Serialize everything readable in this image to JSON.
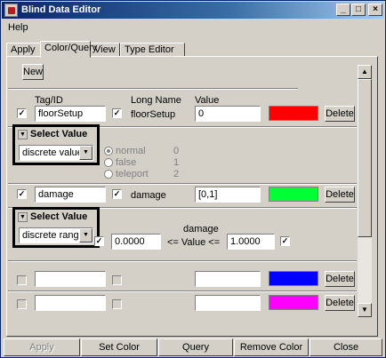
{
  "window": {
    "title": "Blind Data Editor"
  },
  "menu": {
    "items": [
      "Help"
    ]
  },
  "tabs": [
    "Apply",
    "Color/Query",
    "View",
    "Type Editor"
  ],
  "toolbar": {
    "new_label": "New"
  },
  "headers": {
    "tag": "Tag/ID",
    "long_name": "Long Name",
    "value": "Value"
  },
  "rows": [
    {
      "tag": "floorSetup",
      "long_name": "floorSetup",
      "value": "0",
      "color": "#ff0000",
      "delete_label": "Delete",
      "checked": true,
      "long_checked": true
    },
    {
      "tag": "damage",
      "long_name": "damage",
      "value": "[0,1]",
      "color": "#00ff33",
      "delete_label": "Delete",
      "checked": true,
      "long_checked": true
    },
    {
      "tag": "",
      "long_name": "",
      "value": "",
      "color": "#0000ff",
      "delete_label": "Delete",
      "checked": false,
      "long_checked": false
    },
    {
      "tag": "",
      "long_name": "",
      "value": "",
      "color": "#ff00ff",
      "delete_label": "Delete",
      "checked": false,
      "long_checked": false
    }
  ],
  "select1": {
    "title": "Select Value",
    "selected": "discrete value",
    "options": [
      {
        "name": "normal",
        "value": "0",
        "selected": true
      },
      {
        "name": "false",
        "value": "1",
        "selected": false
      },
      {
        "name": "teleport",
        "value": "2",
        "selected": false
      }
    ]
  },
  "select2": {
    "title": "Select Value",
    "selected": "discrete range",
    "attr_label": "damage",
    "min": "0.0000",
    "mid_label": "<= Value <=",
    "max": "1.0000",
    "min_checked": true,
    "max_checked": true
  },
  "bottom": {
    "apply": "Apply",
    "set_color": "Set Color",
    "query": "Query",
    "remove_color": "Remove Color",
    "close": "Close"
  }
}
